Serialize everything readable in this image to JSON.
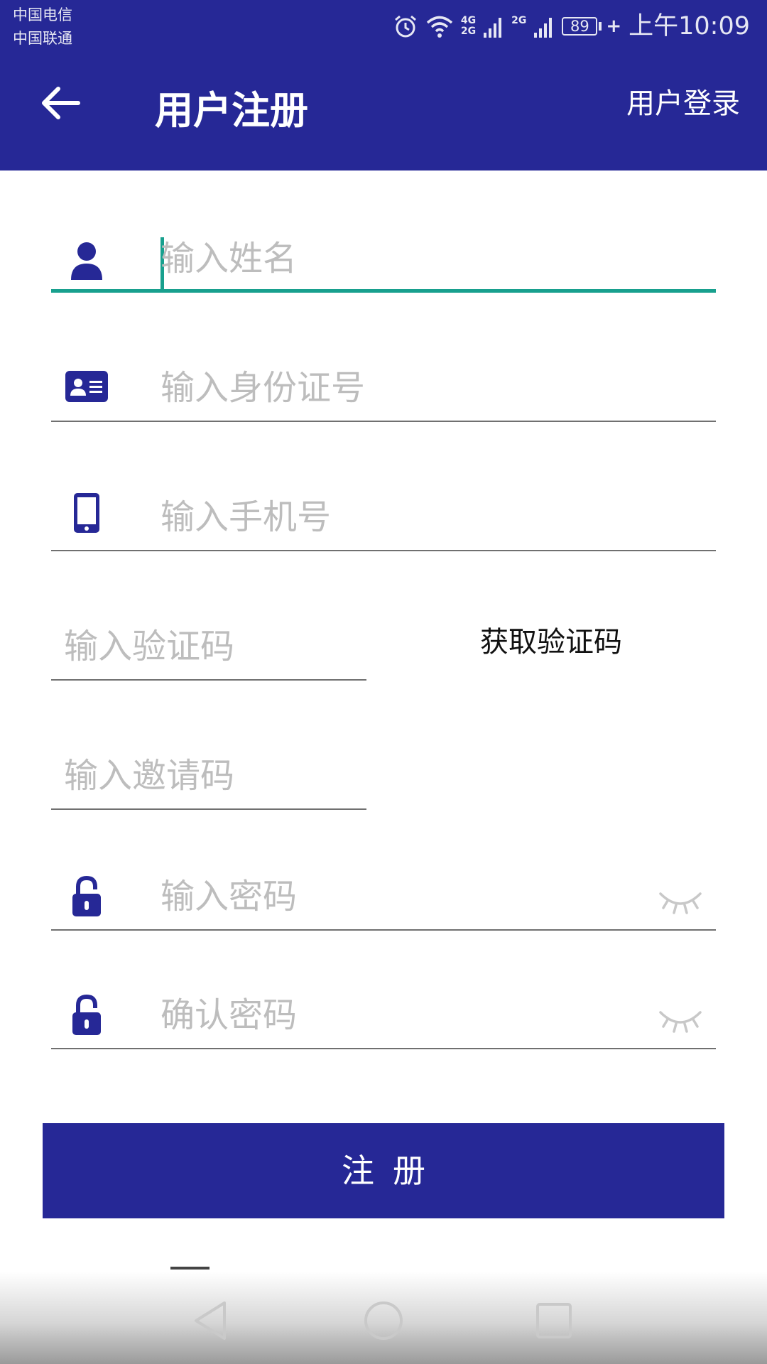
{
  "status_bar": {
    "carrier_1": "中国电信",
    "carrier_2": "中国联通",
    "sim1_network_top": "4G",
    "sim1_network_bottom": "2G",
    "sim2_network": "2G",
    "battery_level": "89",
    "battery_charging_symbol": "+",
    "time": "上午10:09",
    "icons": [
      "alarm-icon",
      "wifi-icon",
      "signal-icon",
      "signal-icon",
      "battery-icon"
    ]
  },
  "header": {
    "back_icon": "arrow-left-icon",
    "title": "用户注册",
    "login_link": "用户登录",
    "background_color": "#262896"
  },
  "form": {
    "name": {
      "placeholder": "输入姓名",
      "value": "",
      "icon": "user-icon",
      "focused": true
    },
    "id_number": {
      "placeholder": "输入身份证号",
      "value": "",
      "icon": "id-card-icon"
    },
    "phone": {
      "placeholder": "输入手机号",
      "value": "",
      "icon": "phone-icon"
    },
    "verification_code": {
      "placeholder": "输入验证码",
      "value": ""
    },
    "get_code_button": "获取验证码",
    "invite_code": {
      "placeholder": "输入邀请码",
      "value": ""
    },
    "password": {
      "placeholder": "输入密码",
      "value": "",
      "icon": "lock-icon",
      "toggle_icon": "eye-closed-icon"
    },
    "confirm_password": {
      "placeholder": "确认密码",
      "value": "",
      "icon": "lock-icon",
      "toggle_icon": "eye-closed-icon"
    },
    "focus_color": "#18a08e",
    "icon_color": "#262896"
  },
  "register_button": {
    "label": "注册"
  },
  "nav_bar": {
    "buttons": [
      "back-triangle-icon",
      "home-circle-icon",
      "recents-square-icon"
    ]
  }
}
